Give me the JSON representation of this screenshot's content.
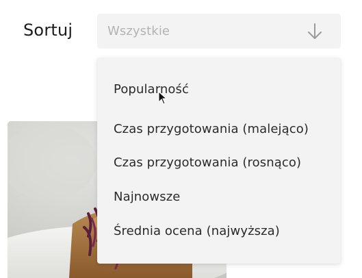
{
  "sort": {
    "label": "Sortuj",
    "select": {
      "value": "Wszystkie",
      "icon": "arrow-down-icon"
    },
    "options": [
      "Popularność",
      "Czas przygotowania (malejąco)",
      "Czas przygotowania (rosnąco)",
      "Najnowsze",
      "Średnia ocena (najwyższa)"
    ]
  },
  "colors": {
    "select_bg": "#f3f3f3",
    "placeholder": "#b3b3b3",
    "text": "#2a2a2a",
    "label": "#1b1b1b"
  }
}
